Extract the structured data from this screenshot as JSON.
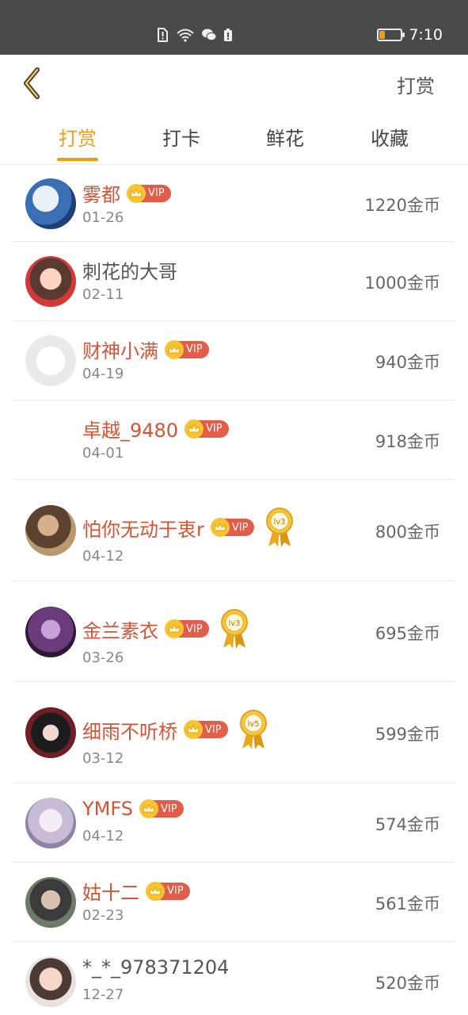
{
  "status_bar": {
    "time": "7:10",
    "icons": [
      "sim-alert-icon",
      "wifi-icon",
      "wechat-icon",
      "battery-saver-icon"
    ],
    "battery_level": 0.25
  },
  "header": {
    "back_icon": "chevron-left-icon",
    "title": "打赏"
  },
  "tabs": [
    {
      "label": "打赏",
      "active": true
    },
    {
      "label": "打卡",
      "active": false
    },
    {
      "label": "鲜花",
      "active": false
    },
    {
      "label": "收藏",
      "active": false
    }
  ],
  "vip_label": "VIP",
  "accent_color": "#f39c12",
  "vip_name_color": "#d35437",
  "rewards": [
    {
      "name": "雾都",
      "vip": true,
      "medal": "",
      "date": "01-26",
      "amount": "1220金币"
    },
    {
      "name": "刺花的大哥",
      "vip": false,
      "medal": "",
      "date": "02-11",
      "amount": "1000金币"
    },
    {
      "name": "财神小满",
      "vip": true,
      "medal": "",
      "date": "04-19",
      "amount": "940金币"
    },
    {
      "name": "卓越_9480",
      "vip": true,
      "medal": "",
      "date": "04-01",
      "amount": "918金币"
    },
    {
      "name": "怕你无动于衷r",
      "vip": true,
      "medal": "lv3",
      "date": "04-12",
      "amount": "800金币"
    },
    {
      "name": "金兰素衣",
      "vip": true,
      "medal": "lv3",
      "date": "03-26",
      "amount": "695金币"
    },
    {
      "name": "细雨不听桥",
      "vip": true,
      "medal": "lv5",
      "date": "03-12",
      "amount": "599金币"
    },
    {
      "name": "YMFS",
      "vip": true,
      "medal": "",
      "date": "04-12",
      "amount": "574金币"
    },
    {
      "name": "姑十二",
      "vip": true,
      "medal": "",
      "date": "02-23",
      "amount": "561金币"
    },
    {
      "name": "*_*_978371204",
      "vip": false,
      "medal": "",
      "date": "12-27",
      "amount": "520金币"
    }
  ]
}
